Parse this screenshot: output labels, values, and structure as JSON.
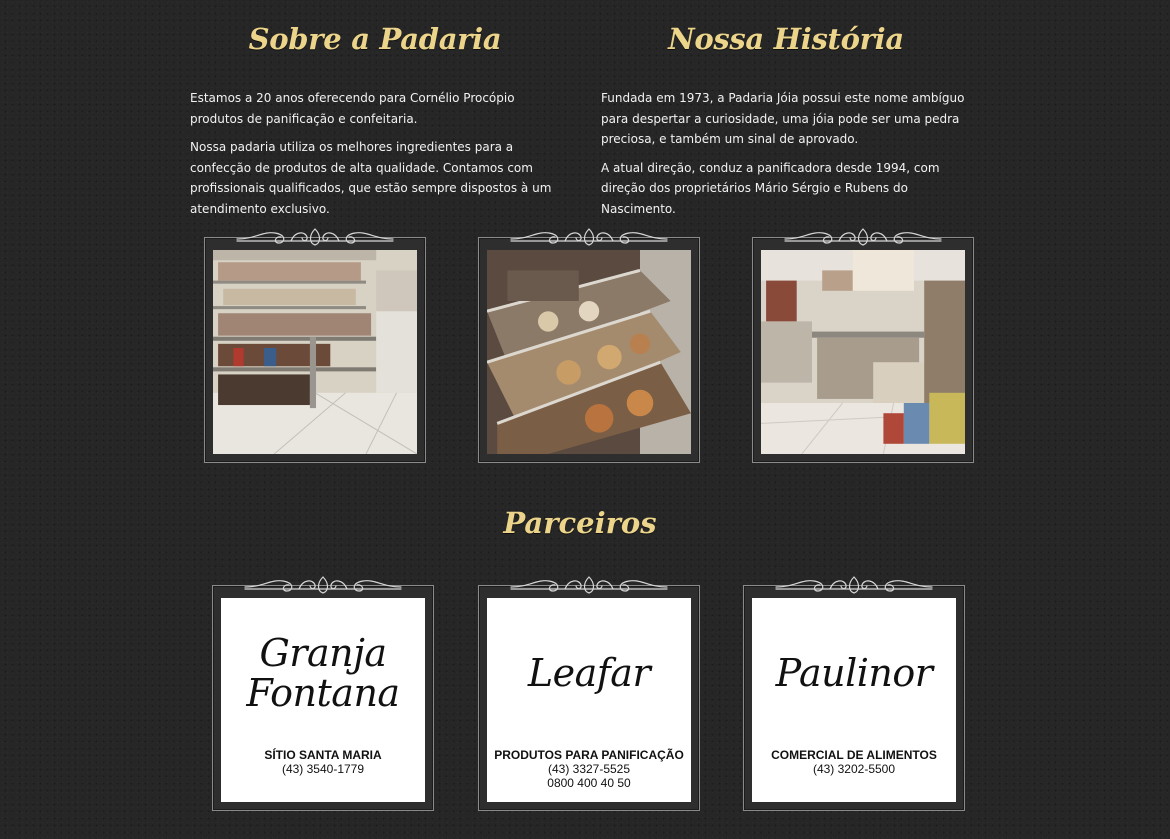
{
  "about": {
    "title": "Sobre a Padaria",
    "paragraphs": [
      "Estamos a 20 anos oferecendo para Cornélio Procópio produtos de panificação e confeitaria.",
      "Nossa padaria utiliza os melhores ingredientes para a confecção de produtos de alta qualidade. Contamos com profissionais qualificados, que estão sempre dispostos à um atendimento exclusivo."
    ]
  },
  "history": {
    "title": "Nossa História",
    "paragraphs": [
      "Fundada em 1973, a Padaria Jóia possui este nome ambíguo para despertar a curiosidade, uma jóia pode ser uma pedra preciosa, e também um sinal de aprovado.",
      "A atual direção, conduz a panificadora desde 1994, com direção dos proprietários Mário Sérgio e Rubens do Nascimento."
    ]
  },
  "gallery": [
    {
      "name": "bakery-shelves-photo"
    },
    {
      "name": "display-case-photo"
    },
    {
      "name": "store-interior-photo"
    }
  ],
  "partners": {
    "title": "Parceiros",
    "items": [
      {
        "logo_line1": "Granja",
        "logo_line2": "Fontana",
        "name": "SÍTIO SANTA MARIA",
        "phone1": "(43) 3540-1779",
        "phone2": ""
      },
      {
        "logo_line1": "Leafar",
        "logo_line2": "",
        "name": "PRODUTOS PARA PANIFICAÇÃO",
        "phone1": "(43) 3327-5525",
        "phone2": "0800 400 40 50"
      },
      {
        "logo_line1": "Paulinor",
        "logo_line2": "",
        "name": "COMERCIAL DE ALIMENTOS",
        "phone1": "(43) 3202-5500",
        "phone2": ""
      }
    ]
  },
  "colors": {
    "heading": "#ecd58a",
    "background": "#262626",
    "frame_border": "#8a8a8a"
  }
}
